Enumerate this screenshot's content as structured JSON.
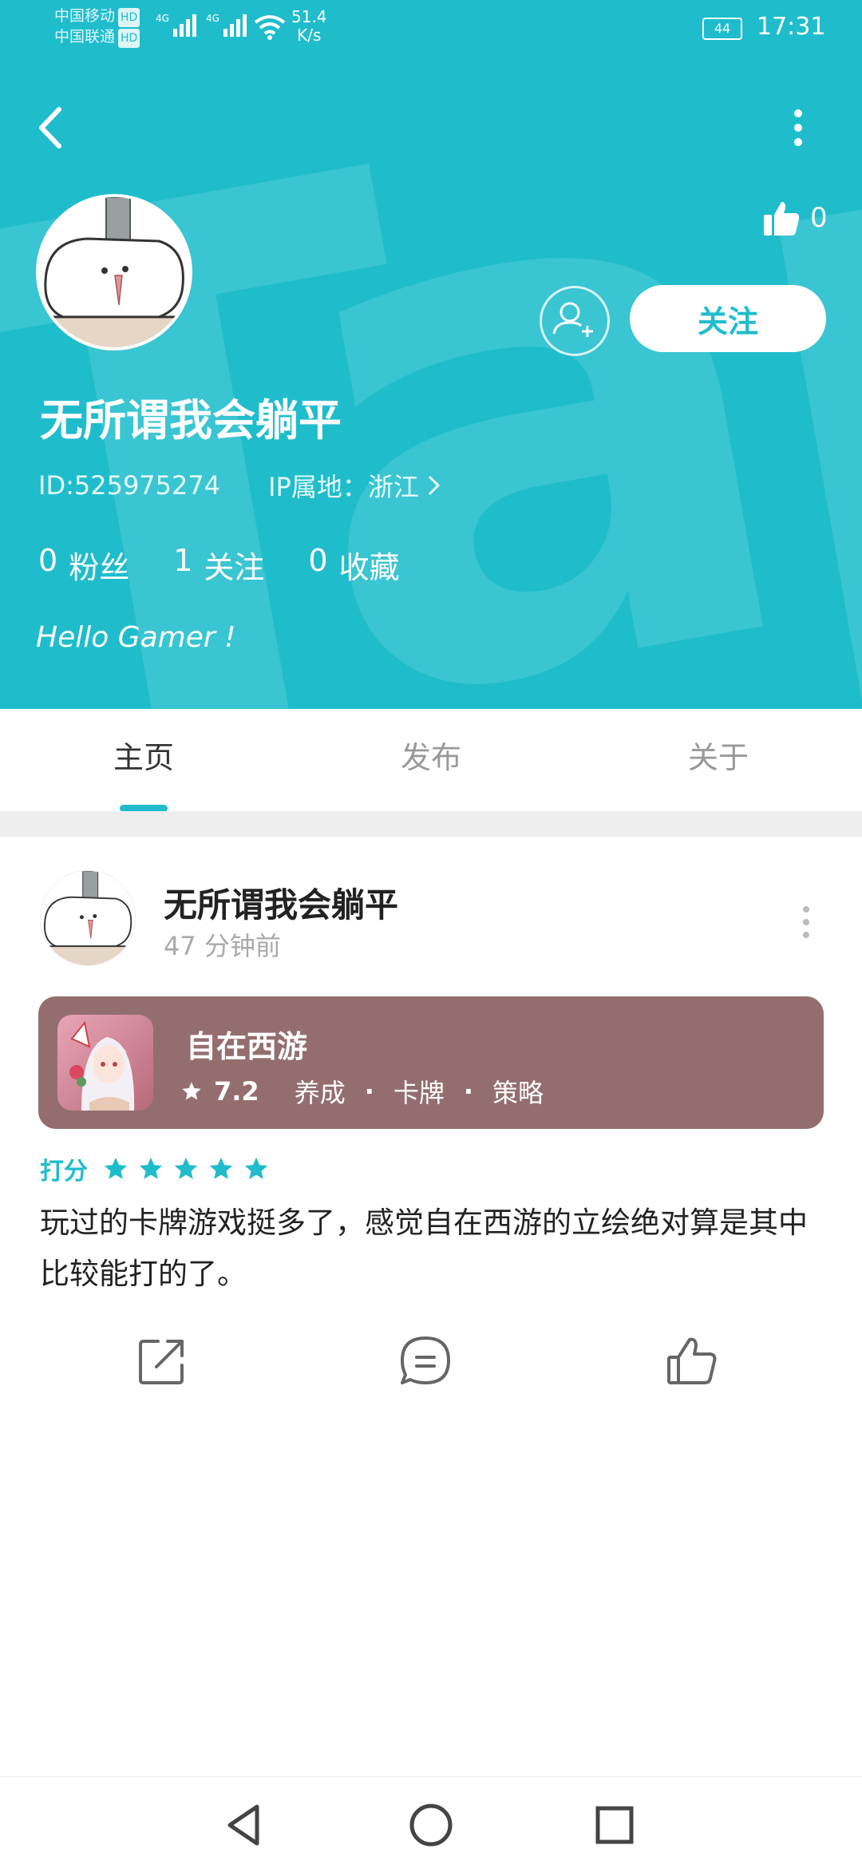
{
  "status_bar": {
    "carrier_1": "中国移动",
    "carrier_2": "中国联通",
    "hd_badge": "HD",
    "network_1": "4G",
    "network_2": "4G",
    "speed_value": "51.4",
    "speed_unit": "K/s",
    "battery": "44",
    "time": "17:31"
  },
  "profile": {
    "like_count": "0",
    "follow_label": "关注",
    "username": "无所谓我会躺平",
    "id_text": "ID:525975274",
    "ip_text": "IP属地：浙江",
    "stats": [
      {
        "count": "0",
        "label": "粉丝"
      },
      {
        "count": "1",
        "label": "关注"
      },
      {
        "count": "0",
        "label": "收藏"
      }
    ],
    "bio": "Hello Gamer !"
  },
  "tabs": [
    {
      "label": "主页",
      "active": true
    },
    {
      "label": "发布",
      "active": false
    },
    {
      "label": "关于",
      "active": false
    }
  ],
  "post": {
    "author": "无所谓我会躺平",
    "time": "47 分钟前",
    "game": {
      "name": "自在西游",
      "score": "7.2",
      "tags": [
        "养成",
        "卡牌",
        "策略"
      ],
      "card_color": "#946e6f"
    },
    "rating_label": "打分",
    "stars": 5,
    "body": "玩过的卡牌游戏挺多了，感觉自在西游的立绘绝对算是其中比较能打的了。"
  },
  "colors": {
    "accent": "#1fbdcc"
  },
  "icons": {
    "back": "chevron-left-icon",
    "more": "more-vertical-icon",
    "like": "thumbs-up-icon",
    "add_friend": "add-user-icon",
    "share": "share-icon",
    "comment": "comment-icon",
    "nav_back": "triangle-back-icon",
    "nav_home": "circle-home-icon",
    "nav_recent": "square-recent-icon"
  }
}
